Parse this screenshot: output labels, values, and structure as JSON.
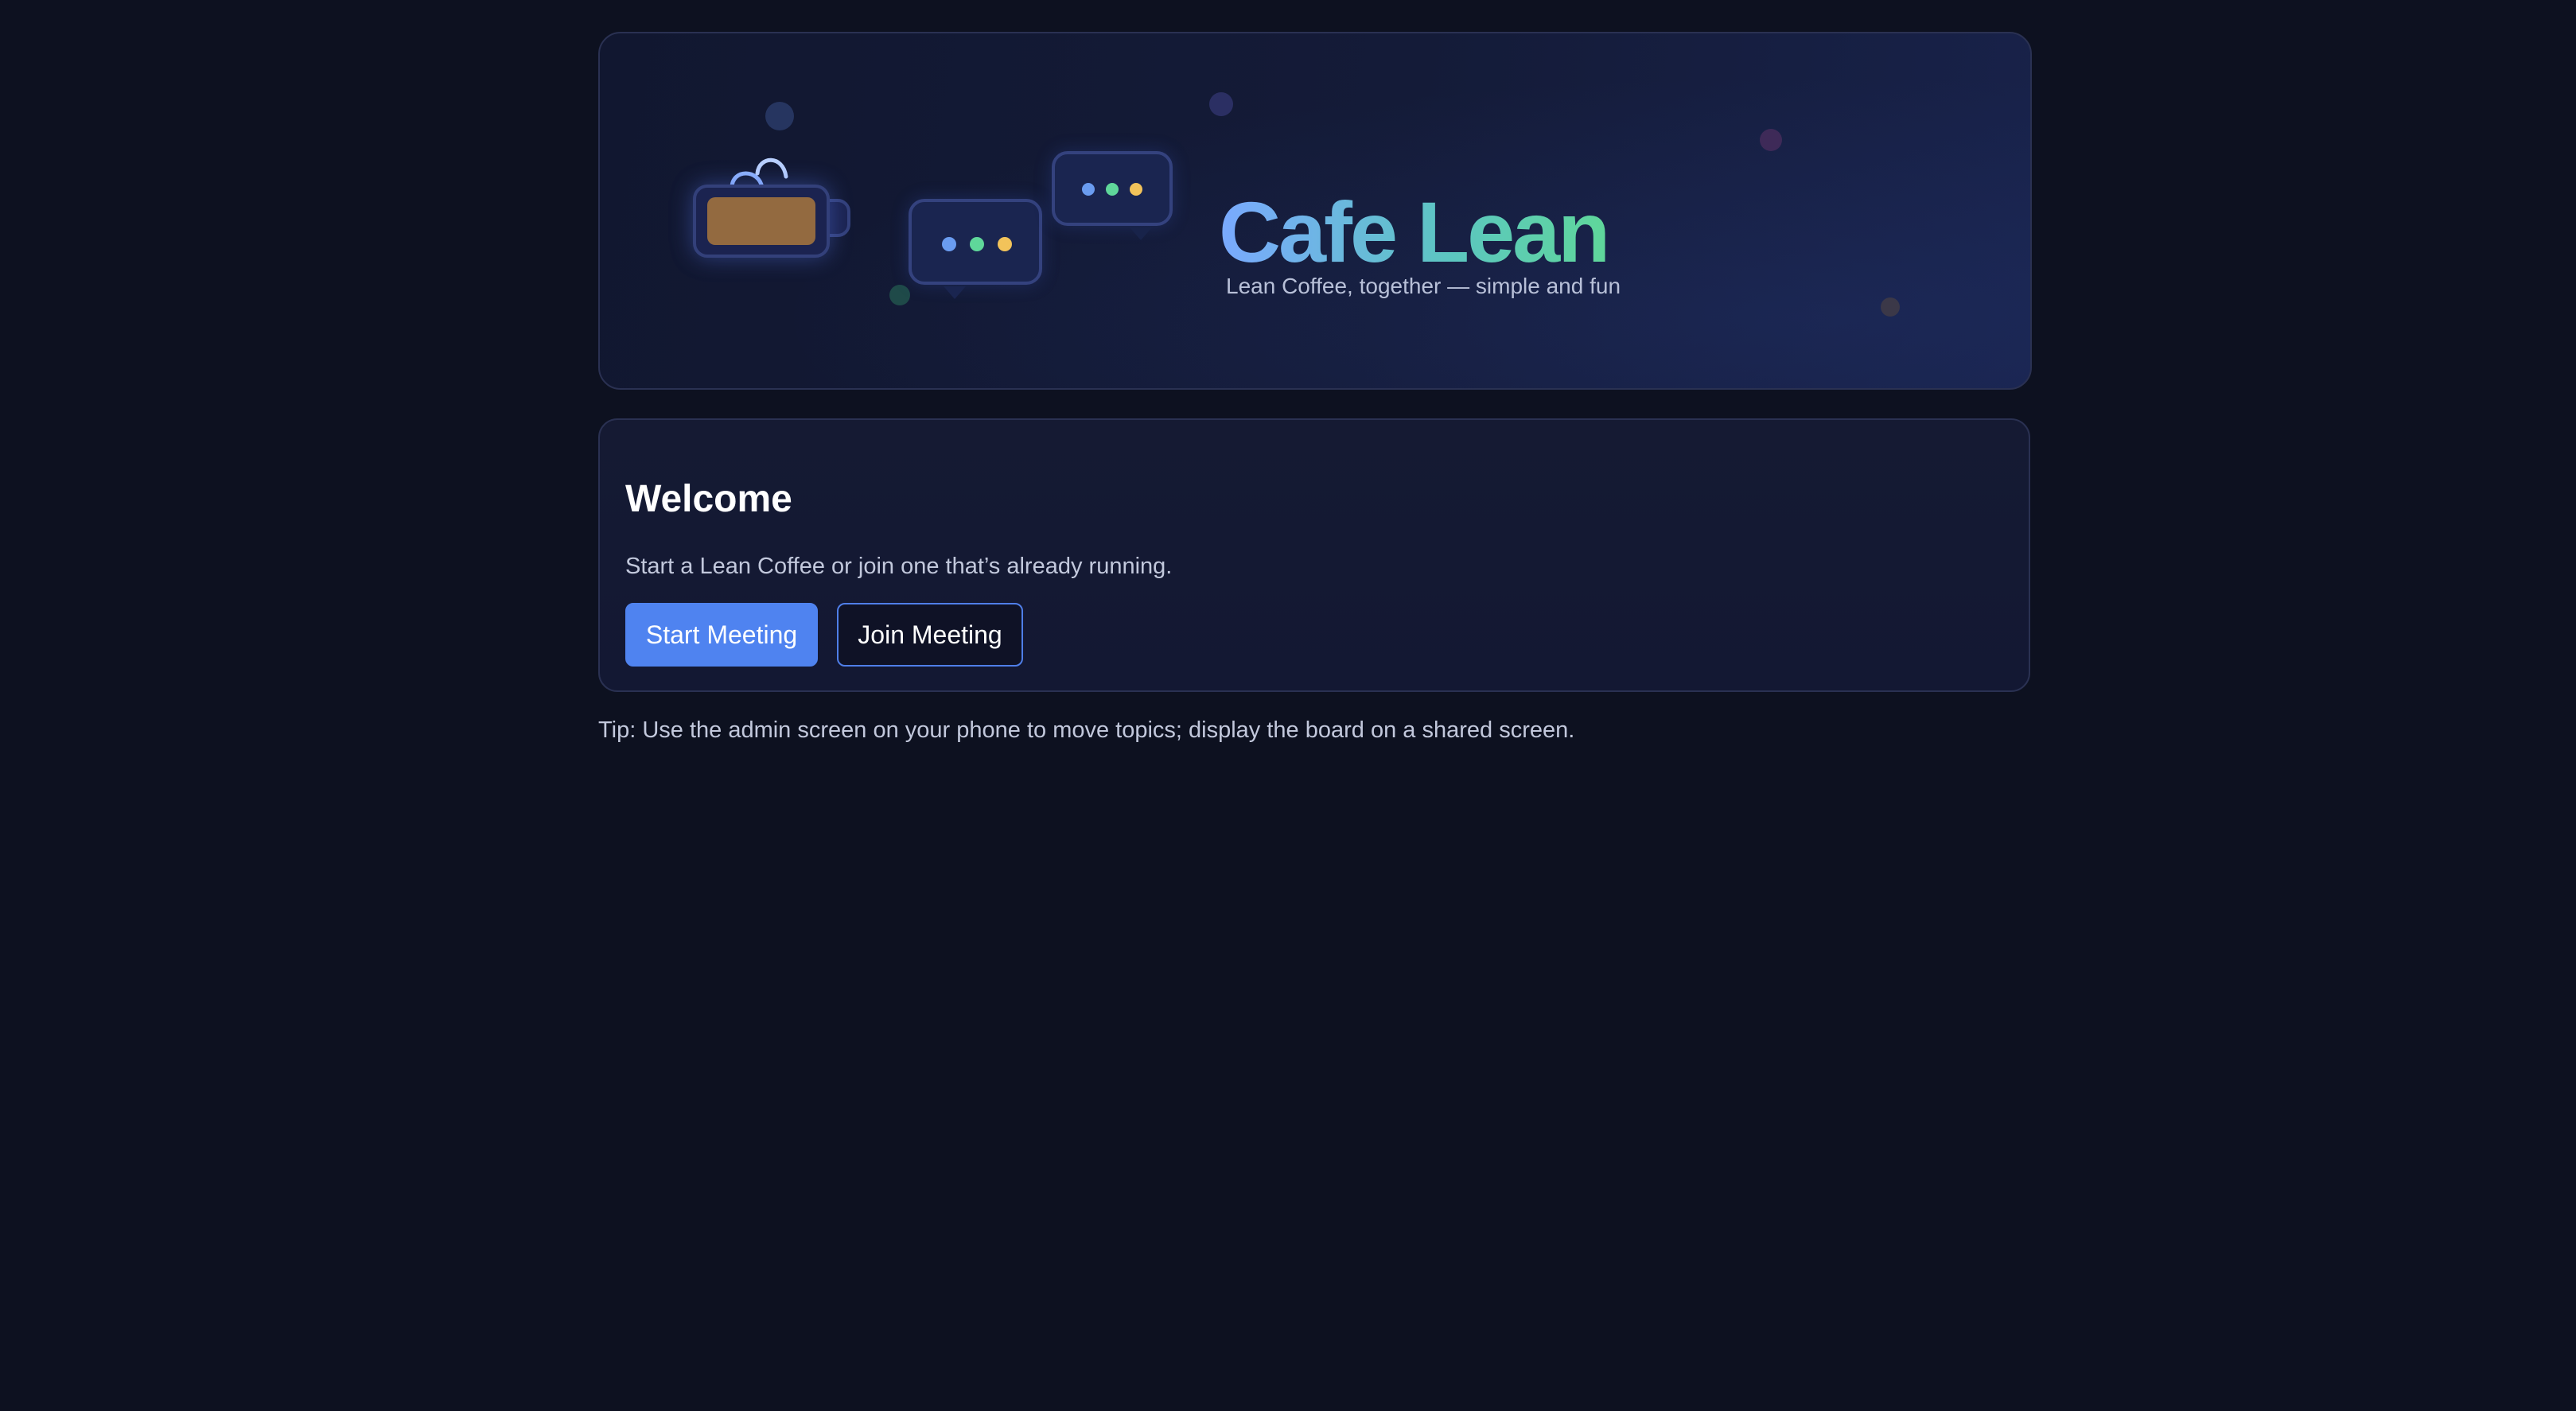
{
  "hero": {
    "title": "Cafe Lean",
    "tagline": "Lean Coffee, together — simple and fun"
  },
  "welcome": {
    "title": "Welcome",
    "text": "Start a Lean Coffee or join one that’s already running.",
    "start_button": "Start Meeting",
    "join_button": "Join Meeting"
  },
  "tip": "Tip: Use the admin screen on your phone to move topics; display the board on a shared screen.",
  "colors": {
    "background": "#0d1120",
    "primary": "#4f83f0",
    "title_gradient_start": "#7aa9ff",
    "title_gradient_end": "#5fd79a",
    "coffee": "#936a40",
    "dot_blue": "#6a9cf0",
    "dot_green": "#5fd79a",
    "dot_yellow": "#f2c35a"
  },
  "icons": [
    "coffee-mug-icon",
    "steam-icon",
    "chat-bubble-icon"
  ]
}
